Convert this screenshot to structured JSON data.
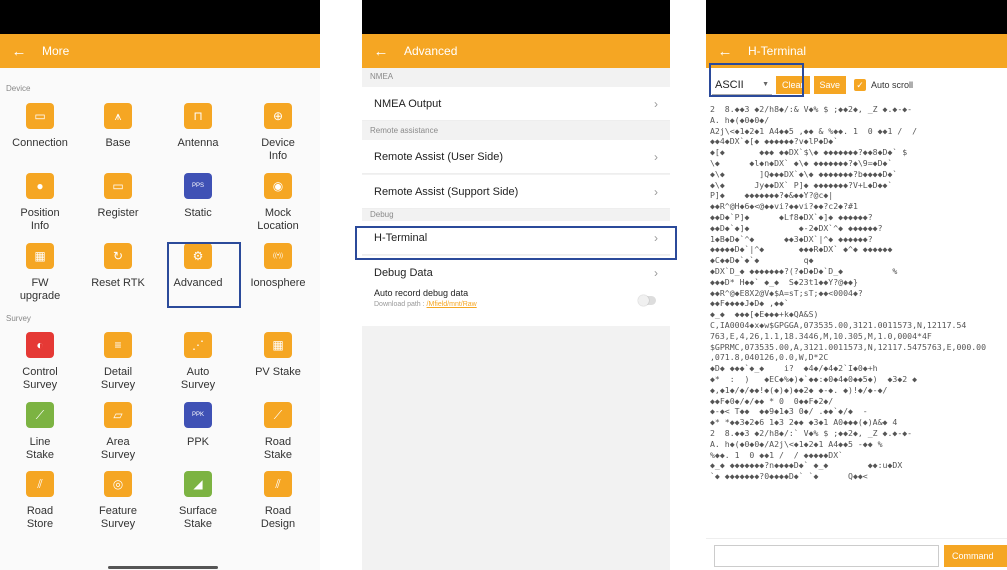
{
  "colors": {
    "accent": "#f5a623",
    "highlight": "#2b4a9a",
    "icon_red": "#e53935",
    "icon_blue": "#3f51b5",
    "icon_green": "#7cb342"
  },
  "more": {
    "title": "More",
    "section_device": "Device",
    "section_survey": "Survey",
    "items": [
      {
        "label": "Connection",
        "icon": "gnss-receiver-icon"
      },
      {
        "label": "Base",
        "icon": "base-tripod-icon"
      },
      {
        "label": "Antenna",
        "icon": "antenna-icon"
      },
      {
        "label": "Device\nInfo",
        "icon": "device-info-icon"
      },
      {
        "label": "Position\nInfo",
        "icon": "position-pin-icon"
      },
      {
        "label": "Register",
        "icon": "register-icon"
      },
      {
        "label": "Static",
        "icon": "static-pps-icon"
      },
      {
        "label": "Mock\nLocation",
        "icon": "mock-location-icon"
      },
      {
        "label": "FW\nupgrade",
        "icon": "chip-icon"
      },
      {
        "label": "Reset RTK",
        "icon": "reset-icon"
      },
      {
        "label": "Advanced",
        "icon": "advanced-gear-icon"
      },
      {
        "label": "Ionosphere",
        "icon": "ionosphere-icon"
      },
      {
        "label": "Control\nSurvey",
        "icon": "control-survey-icon"
      },
      {
        "label": "Detail\nSurvey",
        "icon": "detail-survey-icon"
      },
      {
        "label": "Auto\nSurvey",
        "icon": "auto-survey-icon"
      },
      {
        "label": "PV Stake",
        "icon": "pv-stake-icon"
      },
      {
        "label": "Line\nStake",
        "icon": "line-stake-icon"
      },
      {
        "label": "Area\nSurvey",
        "icon": "area-survey-icon"
      },
      {
        "label": "PPK",
        "icon": "ppk-icon"
      },
      {
        "label": "Road\nStake",
        "icon": "road-stake-icon"
      },
      {
        "label": "Road\nStore",
        "icon": "road-store-icon"
      },
      {
        "label": "Feature\nSurvey",
        "icon": "feature-survey-icon"
      },
      {
        "label": "Surface\nStake",
        "icon": "surface-stake-icon"
      },
      {
        "label": "Road\nDesign",
        "icon": "road-design-icon"
      }
    ]
  },
  "advanced": {
    "title": "Advanced",
    "section_nmea": "NMEA",
    "nmea_output": "NMEA Output",
    "section_remote": "Remote assistance",
    "remote_user": "Remote Assist (User Side)",
    "remote_support": "Remote Assist (Support Side)",
    "section_debug": "Debug",
    "h_terminal": "H-Terminal",
    "debug_data": "Debug Data",
    "auto_record": "Auto record debug data",
    "download_path_label": "Download path : ",
    "download_path": "/Mfield/mnt/Raw"
  },
  "hterminal": {
    "title": "H-Terminal",
    "mode": "ASCII",
    "clear_label": "Clear",
    "save_label": "Save",
    "auto_scroll_label": "Auto scroll",
    "command_label": "Command",
    "output": "2  8.◆◆3 ◆2/h8◆/:& V◆% $ ;◆◆2◆, _Z ◆.◆-◆-\nA. h◆(◆0◆0◆/\nA2j\\<◆1◆2◆1 A4◆◆5 ,◆◆ & %◆◆. 1  0 ◆◆1 /  /\n◆◆4◆DX`◆[◆ ◆◆◆◆◆◆?v◆lP◆D◆`\n◆[◆       ◆◆◆ ◆◆DX`$\\◆ ◆◆◆◆◆◆◆?◆◆8◆D◆` $\n\\◆      ◆l◆n◆DX` ◆\\◆ ◆◆◆◆◆◆◆?◆\\9=◆D◆`\n◆\\◆       ]Q◆◆◆DX`◆\\◆ ◆◆◆◆◆◆◆?b◆◆◆◆D◆`\n◆\\◆      Jy◆◆DX` P]◆ ◆◆◆◆◆◆◆?V+L◆D◆◆`\nP]◆    ◆◆◆◆◆◆◆?◆&◆◆Y?@c◆|\n◆◆R^@H◆6◆<@◆◆vi?◆◆vi?◆◆?c2◆?#1\n◆◆D◆`P]◆      ◆Lf8◆DX`◆]◆ ◆◆◆◆◆◆?\n◆◆D◆`◆]◆          ◆-2◆DX`^◆ ◆◆◆◆◆◆?\n1◆B◆D◆`^◆      ◆◆3◆DX`|^◆ ◆◆◆◆◆◆?\n◆◆◆◆◆D◆`|^◆       ◆◆◆R◆DX` ◆^◆ ◆◆◆◆◆◆\n◆C◆◆D◆`◆`◆         q◆\n◆DX`D_◆ ◆◆◆◆◆◆◆?(?◆D◆D◆`D_◆          %\n◆◆◆D* H◆◆` ◆_◆  S◆23t1◆◆Y?@◆◆}\n◆◆R^@◆E8X2@V◆$A=sT;sT;◆◆<0004◆?\n◆◆F◆◆◆◆J◆D◆ ,◆◆`\n◆_◆  ◆◆◆[◆E◆◆◆+k◆QA&S)\nC,IA0004◆x◆w$GPGGA,073535.00,3121.0011573,N,12117.54\n763,E,4,26,1.1,18.3446,M,10.305,M,1.0,0004*4F\n$GPRMC,073535.00,A,3121.0011573,N,12117.5475763,E,000.00\n,071.8,040126,0.0,W,D*2C\n◆D◆ ◆◆◆`◆_◆    i?  ◆4◆/◆4◆2`I◆0◆+h\n◆*  :  )   ◆EC◆%◆)◆`◆◆:◆0◆4◆0◆◆5◆)  ◆3◆2 ◆\n◆,◆1◆/◆/◆◆!◆(◆)◆)◆◆2◆ ◆-◆. ◆)!◆/◆-◆/\n◆◆F◆0◆/◆/◆◆ * 0  0◆◆F◆2◆/\n◆-◆< T◆◆  ◆◆9◆1◆3 0◆/ .◆◆`◆/◆  -\n◆* *◆◆3◆2◆6 1◆3 2◆◆ ◆3◆1 A0◆◆◆(◆)A&◆ 4\n2  8.◆◆3 ◆2/h8◆/:` V◆% $ ;◆◆2◆, _Z ◆.◆-◆-\nA. h◆(◆0◆0◆/A2j\\<◆1◆2◆1 A4◆◆5 -◆◆ %\n%◆◆. 1  0 ◆◆1 /  / ◆◆◆◆◆DX`\n◆_◆ ◆◆◆◆◆◆◆?n◆◆◆◆D◆` ◆_◆        ◆◆:u◆DX\n`◆ ◆◆◆◆◆◆◆?0◆◆◆◆D◆` `◆      Q◆◆<"
  }
}
